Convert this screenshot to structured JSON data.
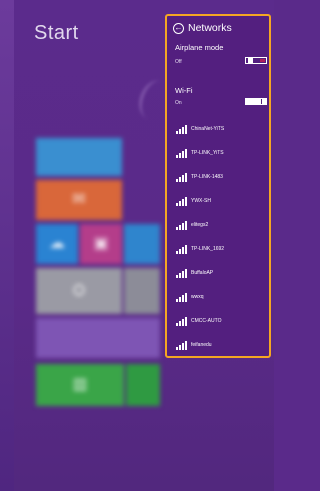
{
  "start": {
    "title": "Start"
  },
  "tiles": [
    {
      "icon": "calendar-icon",
      "color": "#3a8fd0"
    },
    {
      "icon": "mail-icon",
      "color": "#d9673a"
    },
    {
      "icon": "cloud-icon",
      "color": "#2a83d2"
    },
    {
      "icon": "photo-icon",
      "color": "#b43d8a"
    },
    {
      "icon": "map-icon",
      "color": "#2f85cd"
    },
    {
      "icon": "people-icon",
      "color": "#9a9aa4"
    },
    {
      "icon": "video-icon",
      "color": "#7e55b4"
    },
    {
      "icon": "store-icon",
      "color": "#3aa548"
    }
  ],
  "networks": {
    "title": "Networks",
    "airplane_mode": {
      "label": "Airplane mode",
      "state": "Off"
    },
    "wifi": {
      "label": "Wi-Fi",
      "state": "On"
    },
    "networks_list": [
      "ChinaNet-YiTS",
      "TP-LINK_YiTS",
      "TP-LINK-1483",
      "YWX-SH",
      "elitegs2",
      "TP-LINK_1692",
      "BuffaloAP",
      "wwxq",
      "CMCC-AUTO",
      "feifanedu"
    ]
  },
  "colors": {
    "background": "#5a2a8a",
    "panel": "#531f7f",
    "highlight_border": "#f5a623",
    "toggle_off_accent": "#b0205a"
  }
}
